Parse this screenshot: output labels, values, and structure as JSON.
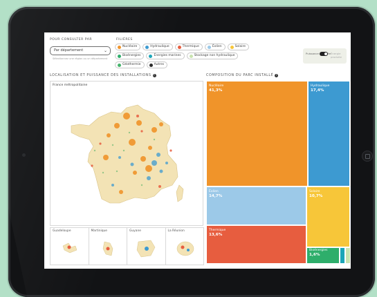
{
  "filters": {
    "view_label": "Pour consulter par",
    "select_value": "Par département",
    "hint": "Sélectionnez une région ou un département",
    "type_label": "Filières",
    "chips": [
      {
        "label": "Nucléaire",
        "color": "#f0942a"
      },
      {
        "label": "Hydraulique",
        "color": "#3d9ad1"
      },
      {
        "label": "Thermique",
        "color": "#e75d3f"
      },
      {
        "label": "Éolien",
        "color": "#9cc9e8"
      },
      {
        "label": "Solaire",
        "color": "#f7c639"
      },
      {
        "label": "Bioénergies",
        "color": "#2eae6b"
      },
      {
        "label": "Énergies marines",
        "color": "#1ca6b8"
      },
      {
        "label": "Stockage non hydraulique",
        "color": "#c8e3b0"
      },
      {
        "label": "Géothermie",
        "color": "#45b36b"
      },
      {
        "label": "Autres",
        "color": "#2b2b2b"
      }
    ],
    "toggle_left": "Puissance installée",
    "toggle_right": "Énergie produite"
  },
  "map": {
    "title": "Localisation et puissance des installations",
    "caption": "France métropolitaine",
    "dom": [
      "Guadeloupe",
      "Martinique",
      "Guyane",
      "La Réunion"
    ]
  },
  "treemap": {
    "title": "Composition du parc installé",
    "cells": [
      {
        "label": "Nucléaire",
        "value": "41,3%",
        "color": "#f0942a"
      },
      {
        "label": "Hydraulique",
        "value": "17,4%",
        "color": "#3d9ad1"
      },
      {
        "label": "Éolien",
        "value": "14,7%",
        "color": "#9cc9e8"
      },
      {
        "label": "Solaire",
        "value": "10,7%",
        "color": "#f7c639"
      },
      {
        "label": "Thermique",
        "value": "13,6%",
        "color": "#e75d3f"
      },
      {
        "label": "Bioénergies",
        "value": "1,6%",
        "color": "#2eae6b"
      }
    ]
  }
}
